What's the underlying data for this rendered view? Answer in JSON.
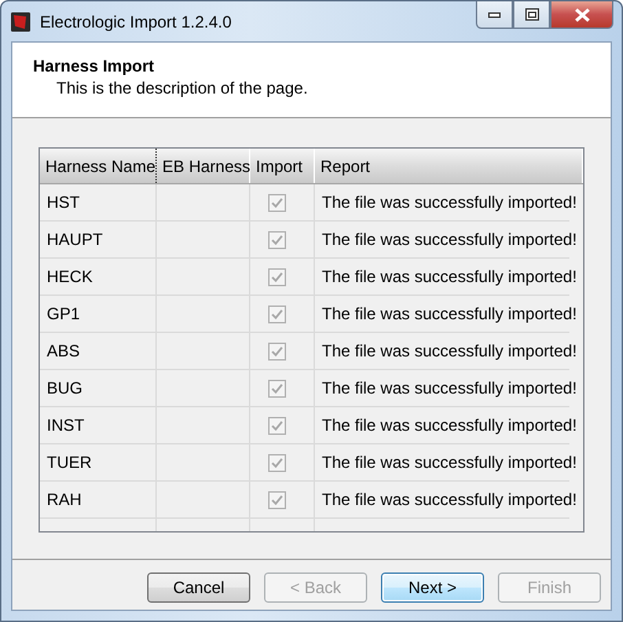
{
  "window": {
    "title": "Electrologic Import 1.2.4.0"
  },
  "header": {
    "title": "Harness Import",
    "description": "This is the description of the page."
  },
  "table": {
    "columns": [
      "Harness Name",
      "EB Harness",
      "Import",
      "Report"
    ],
    "rows": [
      {
        "name": "HST",
        "import": {
          "checked": true,
          "disabled": true
        },
        "report": "The file was successfully imported!"
      },
      {
        "name": "HAUPT",
        "import": {
          "checked": true,
          "disabled": true
        },
        "report": "The file was successfully imported!"
      },
      {
        "name": "HECK",
        "import": {
          "checked": true,
          "disabled": true
        },
        "report": "The file was successfully imported!"
      },
      {
        "name": "GP1",
        "import": {
          "checked": true,
          "disabled": true
        },
        "report": "The file was successfully imported!"
      },
      {
        "name": "ABS",
        "import": {
          "checked": true,
          "disabled": true
        },
        "report": "The file was successfully imported!"
      },
      {
        "name": "BUG",
        "import": {
          "checked": true,
          "disabled": true
        },
        "report": "The file was successfully imported!"
      },
      {
        "name": "INST",
        "import": {
          "checked": true,
          "disabled": true
        },
        "report": "The file was successfully imported!"
      },
      {
        "name": "TUER",
        "import": {
          "checked": true,
          "disabled": true
        },
        "report": "The file was successfully imported!"
      },
      {
        "name": "RAH",
        "import": {
          "checked": true,
          "disabled": true
        },
        "report": "The file was successfully imported!"
      }
    ]
  },
  "buttons": [
    {
      "label": "Cancel",
      "disabled": false,
      "default": false
    },
    {
      "label": "< Back",
      "disabled": true,
      "default": false
    },
    {
      "label": "Next >",
      "disabled": false,
      "default": true
    },
    {
      "label": "Finish",
      "disabled": true,
      "default": false
    }
  ]
}
